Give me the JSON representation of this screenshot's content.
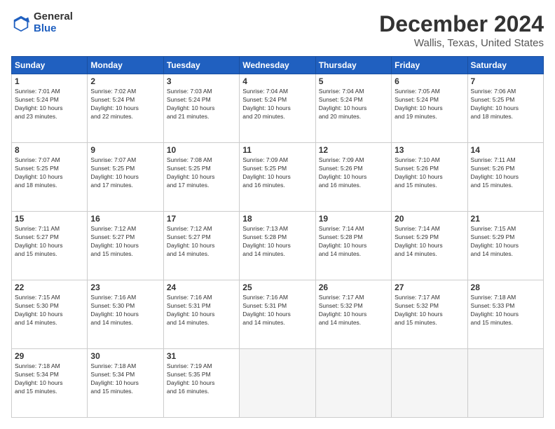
{
  "logo": {
    "general": "General",
    "blue": "Blue"
  },
  "title": "December 2024",
  "subtitle": "Wallis, Texas, United States",
  "days_of_week": [
    "Sunday",
    "Monday",
    "Tuesday",
    "Wednesday",
    "Thursday",
    "Friday",
    "Saturday"
  ],
  "weeks": [
    [
      {
        "day": 1,
        "info": "Sunrise: 7:01 AM\nSunset: 5:24 PM\nDaylight: 10 hours\nand 23 minutes."
      },
      {
        "day": 2,
        "info": "Sunrise: 7:02 AM\nSunset: 5:24 PM\nDaylight: 10 hours\nand 22 minutes."
      },
      {
        "day": 3,
        "info": "Sunrise: 7:03 AM\nSunset: 5:24 PM\nDaylight: 10 hours\nand 21 minutes."
      },
      {
        "day": 4,
        "info": "Sunrise: 7:04 AM\nSunset: 5:24 PM\nDaylight: 10 hours\nand 20 minutes."
      },
      {
        "day": 5,
        "info": "Sunrise: 7:04 AM\nSunset: 5:24 PM\nDaylight: 10 hours\nand 20 minutes."
      },
      {
        "day": 6,
        "info": "Sunrise: 7:05 AM\nSunset: 5:24 PM\nDaylight: 10 hours\nand 19 minutes."
      },
      {
        "day": 7,
        "info": "Sunrise: 7:06 AM\nSunset: 5:25 PM\nDaylight: 10 hours\nand 18 minutes."
      }
    ],
    [
      {
        "day": 8,
        "info": "Sunrise: 7:07 AM\nSunset: 5:25 PM\nDaylight: 10 hours\nand 18 minutes."
      },
      {
        "day": 9,
        "info": "Sunrise: 7:07 AM\nSunset: 5:25 PM\nDaylight: 10 hours\nand 17 minutes."
      },
      {
        "day": 10,
        "info": "Sunrise: 7:08 AM\nSunset: 5:25 PM\nDaylight: 10 hours\nand 17 minutes."
      },
      {
        "day": 11,
        "info": "Sunrise: 7:09 AM\nSunset: 5:25 PM\nDaylight: 10 hours\nand 16 minutes."
      },
      {
        "day": 12,
        "info": "Sunrise: 7:09 AM\nSunset: 5:26 PM\nDaylight: 10 hours\nand 16 minutes."
      },
      {
        "day": 13,
        "info": "Sunrise: 7:10 AM\nSunset: 5:26 PM\nDaylight: 10 hours\nand 15 minutes."
      },
      {
        "day": 14,
        "info": "Sunrise: 7:11 AM\nSunset: 5:26 PM\nDaylight: 10 hours\nand 15 minutes."
      }
    ],
    [
      {
        "day": 15,
        "info": "Sunrise: 7:11 AM\nSunset: 5:27 PM\nDaylight: 10 hours\nand 15 minutes."
      },
      {
        "day": 16,
        "info": "Sunrise: 7:12 AM\nSunset: 5:27 PM\nDaylight: 10 hours\nand 15 minutes."
      },
      {
        "day": 17,
        "info": "Sunrise: 7:12 AM\nSunset: 5:27 PM\nDaylight: 10 hours\nand 14 minutes."
      },
      {
        "day": 18,
        "info": "Sunrise: 7:13 AM\nSunset: 5:28 PM\nDaylight: 10 hours\nand 14 minutes."
      },
      {
        "day": 19,
        "info": "Sunrise: 7:14 AM\nSunset: 5:28 PM\nDaylight: 10 hours\nand 14 minutes."
      },
      {
        "day": 20,
        "info": "Sunrise: 7:14 AM\nSunset: 5:29 PM\nDaylight: 10 hours\nand 14 minutes."
      },
      {
        "day": 21,
        "info": "Sunrise: 7:15 AM\nSunset: 5:29 PM\nDaylight: 10 hours\nand 14 minutes."
      }
    ],
    [
      {
        "day": 22,
        "info": "Sunrise: 7:15 AM\nSunset: 5:30 PM\nDaylight: 10 hours\nand 14 minutes."
      },
      {
        "day": 23,
        "info": "Sunrise: 7:16 AM\nSunset: 5:30 PM\nDaylight: 10 hours\nand 14 minutes."
      },
      {
        "day": 24,
        "info": "Sunrise: 7:16 AM\nSunset: 5:31 PM\nDaylight: 10 hours\nand 14 minutes."
      },
      {
        "day": 25,
        "info": "Sunrise: 7:16 AM\nSunset: 5:31 PM\nDaylight: 10 hours\nand 14 minutes."
      },
      {
        "day": 26,
        "info": "Sunrise: 7:17 AM\nSunset: 5:32 PM\nDaylight: 10 hours\nand 14 minutes."
      },
      {
        "day": 27,
        "info": "Sunrise: 7:17 AM\nSunset: 5:32 PM\nDaylight: 10 hours\nand 15 minutes."
      },
      {
        "day": 28,
        "info": "Sunrise: 7:18 AM\nSunset: 5:33 PM\nDaylight: 10 hours\nand 15 minutes."
      }
    ],
    [
      {
        "day": 29,
        "info": "Sunrise: 7:18 AM\nSunset: 5:34 PM\nDaylight: 10 hours\nand 15 minutes."
      },
      {
        "day": 30,
        "info": "Sunrise: 7:18 AM\nSunset: 5:34 PM\nDaylight: 10 hours\nand 15 minutes."
      },
      {
        "day": 31,
        "info": "Sunrise: 7:19 AM\nSunset: 5:35 PM\nDaylight: 10 hours\nand 16 minutes."
      },
      null,
      null,
      null,
      null
    ]
  ]
}
